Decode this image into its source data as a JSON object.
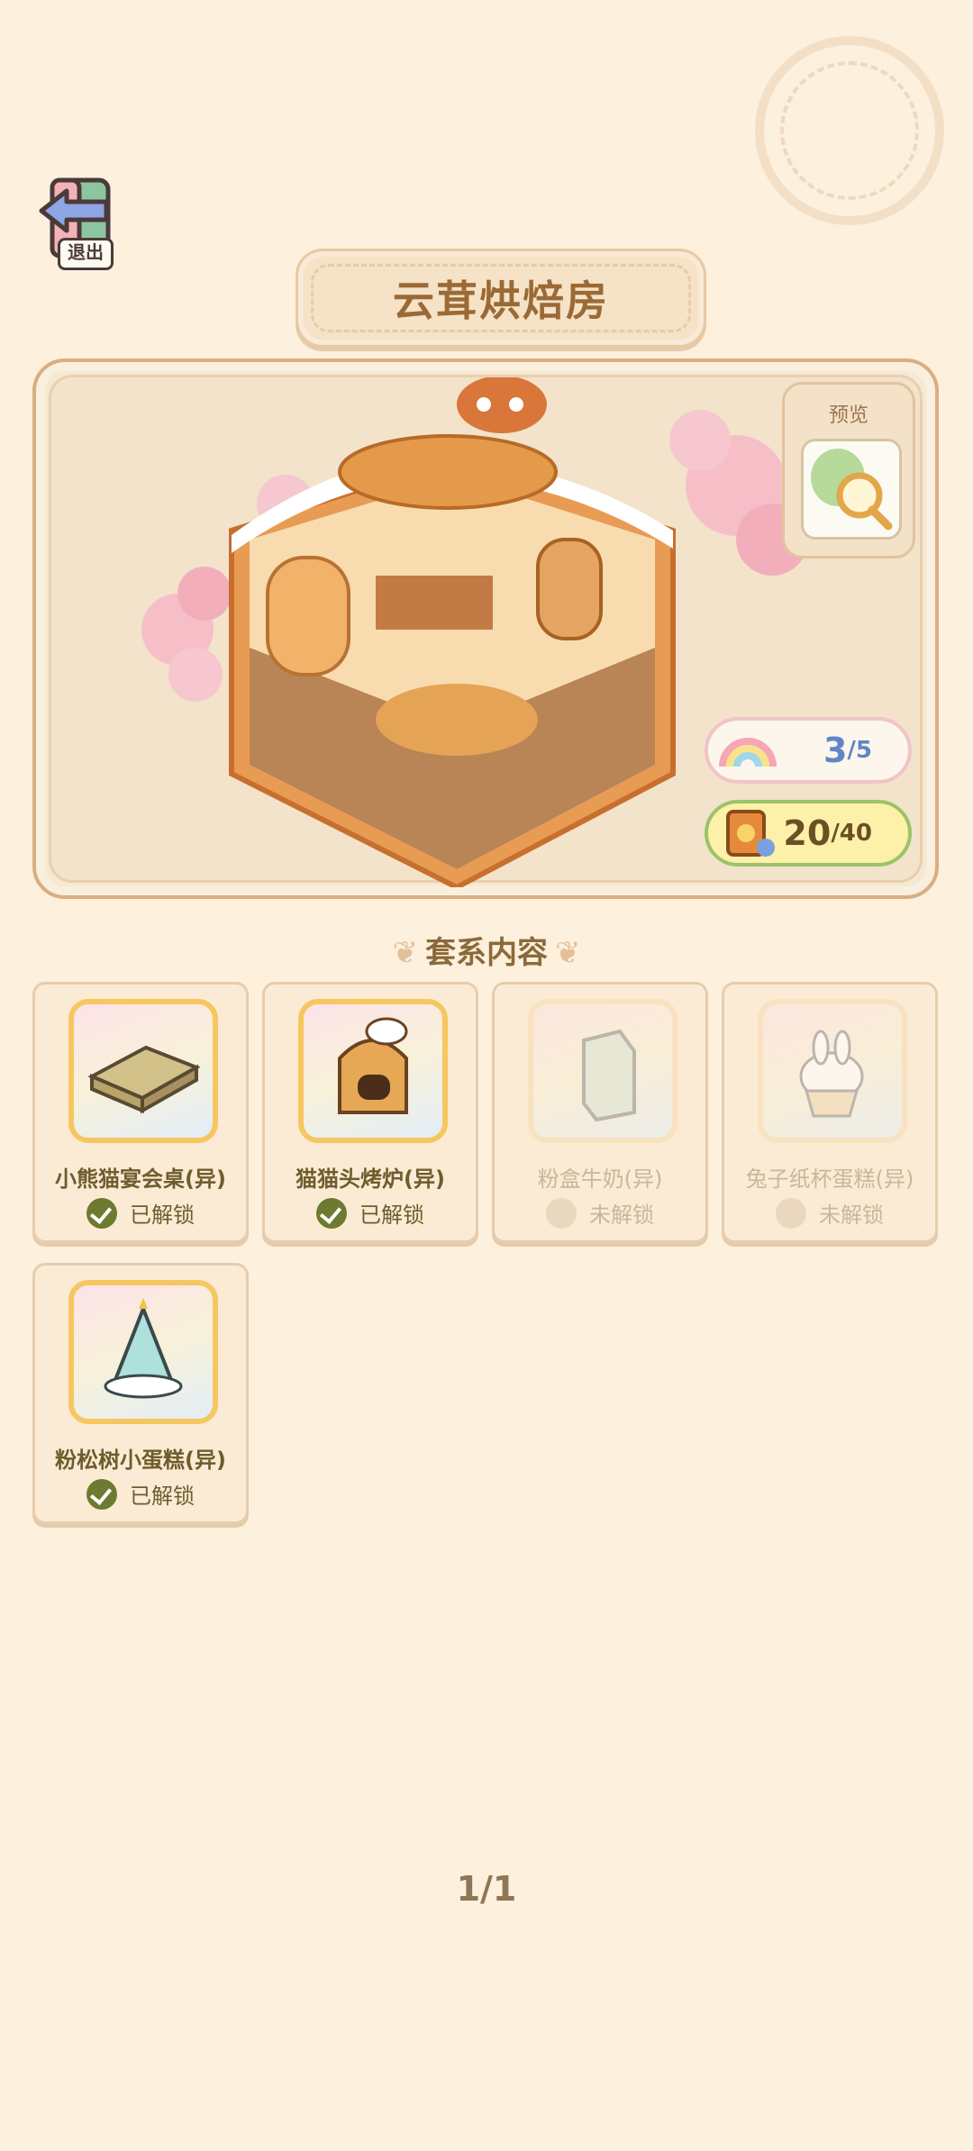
{
  "exit_button": {
    "label": "退出"
  },
  "title": "云茸烘焙房",
  "preview": {
    "label": "预览"
  },
  "stats": {
    "rainbow": {
      "current": "3",
      "total": "/5"
    },
    "book": {
      "current": "20",
      "total": "/40"
    }
  },
  "section_header": "套系内容",
  "items": [
    {
      "name": "小熊猫宴会桌(异)",
      "status": "已解锁",
      "unlocked": true
    },
    {
      "name": "猫猫头烤炉(异)",
      "status": "已解锁",
      "unlocked": true
    },
    {
      "name": "粉盒牛奶(异)",
      "status": "未解锁",
      "unlocked": false
    },
    {
      "name": "兔子纸杯蛋糕(异)",
      "status": "未解锁",
      "unlocked": false
    },
    {
      "name": "粉松树小蛋糕(异)",
      "status": "已解锁",
      "unlocked": true
    }
  ],
  "pager": "1/1"
}
